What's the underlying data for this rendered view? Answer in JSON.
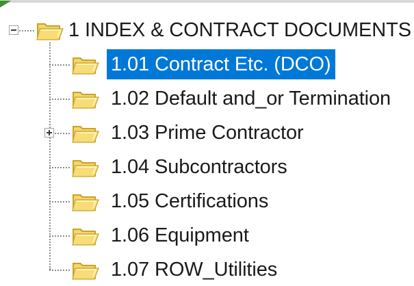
{
  "tree": {
    "root": {
      "label": "1 INDEX & CONTRACT DOCUMENTS",
      "expanded": true
    },
    "children": [
      {
        "label": "1.01 Contract Etc. (DCO)",
        "selected": true,
        "has_children": false
      },
      {
        "label": "1.02 Default and_or Termination",
        "selected": false,
        "has_children": false
      },
      {
        "label": "1.03 Prime Contractor",
        "selected": false,
        "has_children": true,
        "expanded": false
      },
      {
        "label": "1.04 Subcontractors",
        "selected": false,
        "has_children": false
      },
      {
        "label": "1.05 Certifications",
        "selected": false,
        "has_children": false
      },
      {
        "label": "1.06 Equipment",
        "selected": false,
        "has_children": false
      },
      {
        "label": "1.07 ROW_Utilities",
        "selected": false,
        "has_children": false
      }
    ]
  },
  "colors": {
    "selection": "#0078d7",
    "folder_fill": "#f5d66b",
    "folder_edge": "#c9a227",
    "folder_inner": "#fff3b8"
  },
  "icons": {
    "folder": "folder-icon",
    "expand": "plus-box-icon",
    "collapse": "minus-box-icon"
  }
}
